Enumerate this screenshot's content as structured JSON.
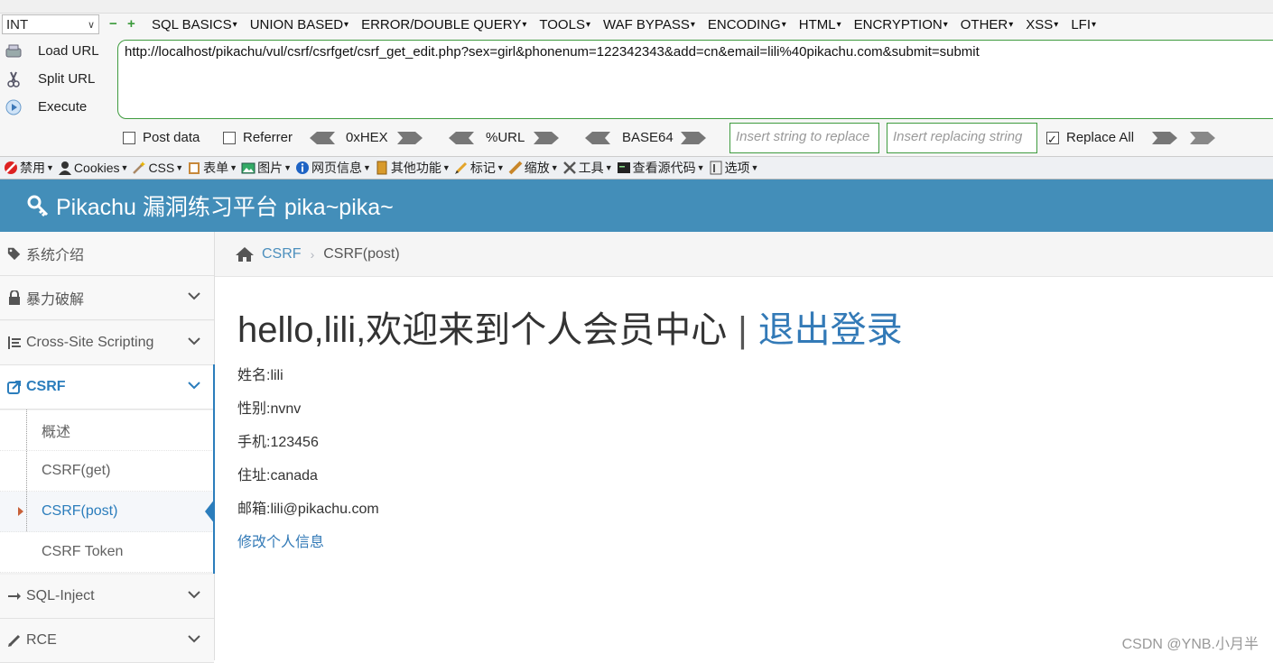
{
  "hackbar": {
    "select_value": "INT",
    "menu": [
      "SQL BASICS",
      "UNION BASED",
      "ERROR/DOUBLE QUERY",
      "TOOLS",
      "WAF BYPASS",
      "ENCODING",
      "HTML",
      "ENCRYPTION",
      "OTHER",
      "XSS",
      "LFI"
    ],
    "load_url": "Load URL",
    "split_url": "Split URL",
    "execute": "Execute",
    "url": "http://localhost/pikachu/vul/csrf/csrfget/csrf_get_edit.php?sex=girl&phonenum=122342343&add=cn&email=lili%40pikachu.com&submit=submit",
    "post_data": "Post data",
    "referrer": "Referrer",
    "hex": "0xHEX",
    "urlenc": "%URL",
    "base64": "BASE64",
    "replace_placeholder": "Insert string to replace",
    "replacing_placeholder": "Insert replacing string",
    "replace_all": "Replace All"
  },
  "toolbar2": [
    "禁用",
    "Cookies",
    "CSS",
    "表单",
    "图片",
    "网页信息",
    "其他功能",
    "标记",
    "缩放",
    "工具",
    "查看源代码",
    "选项"
  ],
  "site": {
    "title": "Pikachu 漏洞练习平台 pika~pika~"
  },
  "sidebar": {
    "items": [
      "系统介绍",
      "暴力破解",
      "Cross-Site Scripting",
      "CSRF",
      "SQL-Inject",
      "RCE"
    ],
    "sub": [
      "概述",
      "CSRF(get)",
      "CSRF(post)",
      "CSRF Token"
    ]
  },
  "breadcrumb": {
    "link": "CSRF",
    "current": "CSRF(post)"
  },
  "main": {
    "welcome": "hello,lili,欢迎来到个人会员中心",
    "separator": "|",
    "logout": "退出登录",
    "name": "姓名:lili",
    "sex": "性别:nvnv",
    "phone": "手机:123456",
    "address": "住址:canada",
    "email": "邮箱:lili@pikachu.com",
    "edit": "修改个人信息"
  },
  "watermark": "CSDN @YNB.小月半",
  "colors": {
    "header": "#438eb9",
    "accent": "#2b7dbc",
    "link": "#337ab7",
    "hackbar_green": "#3f9b3f"
  }
}
